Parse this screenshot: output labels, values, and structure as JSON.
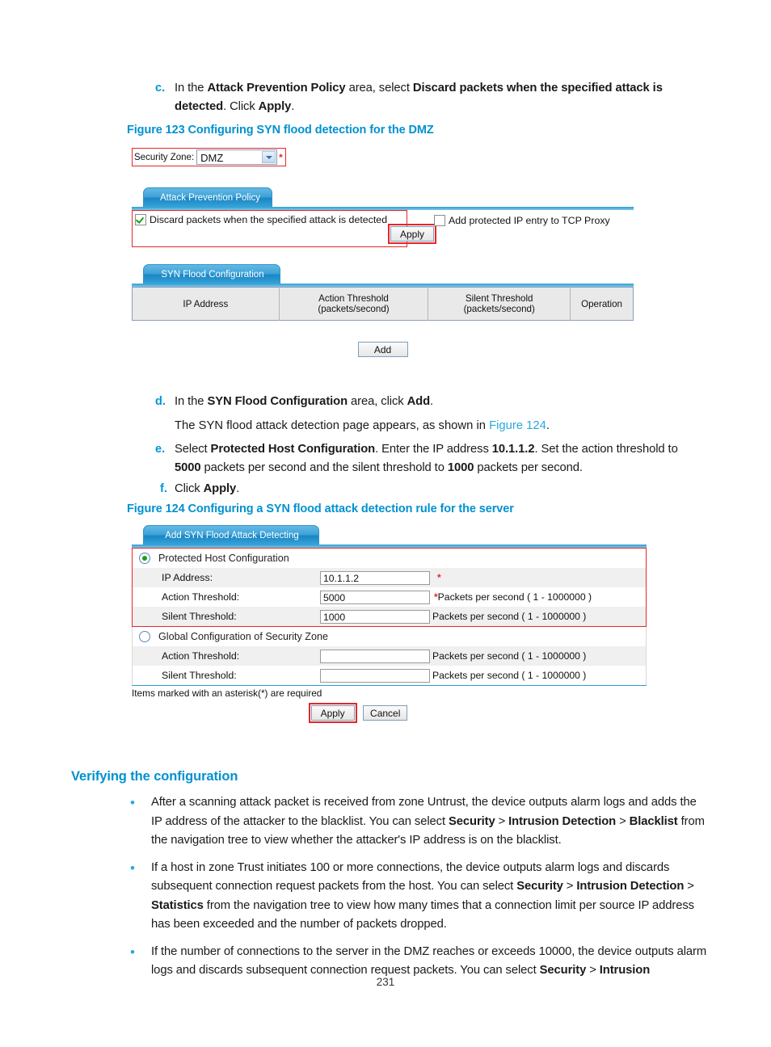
{
  "page": {
    "number": "231"
  },
  "steps_top": {
    "c": {
      "marker": "c.",
      "line1_pre": "In the ",
      "line1_b1": "Attack Prevention Policy",
      "line1_mid": " area, select ",
      "line1_b2": "Discard packets when the specified attack is",
      "line2_b2cont": "detected",
      "line2_mid": ". Click ",
      "line2_b3": "Apply",
      "line2_end": "."
    }
  },
  "figure123": {
    "caption": "Figure 123 Configuring SYN flood detection for the DMZ",
    "security_zone": {
      "label": "Security Zone:",
      "value": "DMZ",
      "required_marker": "*",
      "dropdown_icon": "chevron-down-icon"
    },
    "attack_prevention_policy": {
      "tab_label": "Attack Prevention Policy",
      "checkbox_discard_label": "Discard packets when the specified attack is detected",
      "checkbox_discard_checked": true,
      "checkbox_tcpproxy_label": "Add protected IP entry to TCP Proxy",
      "checkbox_tcpproxy_checked": false,
      "apply_label": "Apply"
    },
    "syn_flood_configuration": {
      "tab_label": "SYN Flood Configuration",
      "columns": [
        "IP Address",
        "Action Threshold\n(packets/second)",
        "Silent Threshold\n(packets/second)",
        "Operation"
      ],
      "col_ip": "IP Address",
      "col_action_l1": "Action Threshold",
      "col_action_l2": "(packets/second)",
      "col_silent_l1": "Silent Threshold",
      "col_silent_l2": "(packets/second)",
      "col_operation": "Operation",
      "rows": [],
      "add_label": "Add"
    }
  },
  "steps_mid": {
    "d": {
      "marker": "d.",
      "pre": "In the ",
      "b1": "SYN Flood Configuration",
      "mid": " area, click ",
      "b2": "Add",
      "end": ".",
      "sub_pre": "The SYN flood attack detection page appears, as shown in ",
      "sub_link": "Figure 124",
      "sub_end": "."
    },
    "e": {
      "marker": "e.",
      "pre": "Select ",
      "b1": "Protected Host Configuration",
      "mid1": ". Enter the IP address ",
      "b2": "10.1.1.2",
      "mid2": ". Set the action threshold to",
      "line2_b3": "5000",
      "line2_mid": " packets per second and the silent threshold to ",
      "line2_b4": "1000",
      "line2_end": " packets per second."
    },
    "f": {
      "marker": "f.",
      "pre": "Click ",
      "b1": "Apply",
      "end": "."
    }
  },
  "figure124": {
    "caption": "Figure 124 Configuring a SYN flood attack detection rule for the server",
    "tab_label": "Add SYN Flood Attack Detecting",
    "protected_host": {
      "radio_label": "Protected Host Configuration",
      "selected": true,
      "ip_address_label": "IP Address:",
      "ip_address_value": "10.1.1.2",
      "ip_address_star": "*",
      "action_threshold_label": "Action Threshold:",
      "action_threshold_value": "5000",
      "action_threshold_star": "*",
      "action_threshold_hint": "Packets per second ( 1 - 1000000 )",
      "silent_threshold_label": "Silent Threshold:",
      "silent_threshold_value": "1000",
      "silent_threshold_hint": "Packets per second ( 1 - 1000000 )"
    },
    "global_zone": {
      "radio_label": "Global Configuration of Security Zone",
      "selected": false,
      "action_threshold_label": "Action Threshold:",
      "action_threshold_value": "",
      "action_threshold_hint": "Packets per second ( 1 - 1000000 )",
      "silent_threshold_label": "Silent Threshold:",
      "silent_threshold_value": "",
      "silent_threshold_hint": "Packets per second ( 1 - 1000000 )"
    },
    "footer_note": "Items marked with an asterisk(*) are required",
    "apply_label": "Apply",
    "cancel_label": "Cancel"
  },
  "verifying": {
    "heading": "Verifying the configuration",
    "b1_p1": "After a scanning attack packet is received from zone Untrust, the device outputs alarm logs and adds the IP address of the attacker to the blacklist. You can select ",
    "b1_s1": "Security",
    "b1_sep1": " > ",
    "b1_s2": "Intrusion Detection",
    "b1_sep2": " > ",
    "b1_s3": "Blacklist",
    "b1_p2": " from the navigation tree to view whether the attacker's IP address is on the blacklist.",
    "b2_p1": "If a host in zone Trust initiates 100 or more connections, the device outputs alarm logs and discards subsequent connection request packets from the host. You can select ",
    "b2_s1": "Security",
    "b2_sep1": " > ",
    "b2_s2": "Intrusion Detection",
    "b2_sep2": " > ",
    "b2_s3": "Statistics",
    "b2_p2": " from the navigation tree to view how many times that a connection limit per source IP address has been exceeded and the number of packets dropped.",
    "b3_p1": "If the number of connections to the server in the DMZ reaches or exceeds 10000, the device outputs alarm logs and discards subsequent connection request packets. You can select ",
    "b3_s1": "Security",
    "b3_sep1": " > ",
    "b3_s2": "Intrusion"
  },
  "colors": {
    "accent_blue": "#0091d0",
    "link_blue": "#2aa7e0",
    "highlight_red": "#e8252a",
    "tab_blue": "#1b86c4"
  }
}
